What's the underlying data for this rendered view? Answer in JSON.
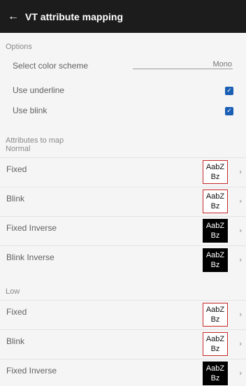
{
  "app_bar": {
    "back_icon": "←",
    "title": "VT attribute mapping"
  },
  "options": {
    "header": "Options",
    "color_scheme": {
      "label": "Select color scheme",
      "value": "Mono"
    },
    "underline": {
      "label": "Use underline",
      "checked": true
    },
    "blink": {
      "label": "Use blink",
      "checked": true
    }
  },
  "attributes": {
    "header": "Attributes to map",
    "normal": {
      "header": "Normal",
      "rows": [
        {
          "label": "Fixed",
          "sample": "AabZ Bz",
          "style": "normal"
        },
        {
          "label": "Blink",
          "sample": "AabZ Bz",
          "style": "normal"
        },
        {
          "label": "Fixed Inverse",
          "sample": "AabZ Bz",
          "style": "inverse"
        },
        {
          "label": "Blink Inverse",
          "sample": "AabZ Bz",
          "style": "inverse"
        }
      ]
    },
    "low": {
      "header": "Low",
      "rows": [
        {
          "label": "Fixed",
          "sample": "AabZ Bz",
          "style": "normal"
        },
        {
          "label": "Blink",
          "sample": "AabZ Bz",
          "style": "normal"
        },
        {
          "label": "Fixed Inverse",
          "sample": "AabZ Bz",
          "style": "inverse"
        }
      ]
    }
  },
  "icons": {
    "chevron": "›",
    "check": "✓"
  },
  "colors": {
    "app_bar": "#1c1c1c",
    "checkbox": "#1a5fb4",
    "sample_border": "#c62828",
    "background": "#f5f5f5"
  }
}
